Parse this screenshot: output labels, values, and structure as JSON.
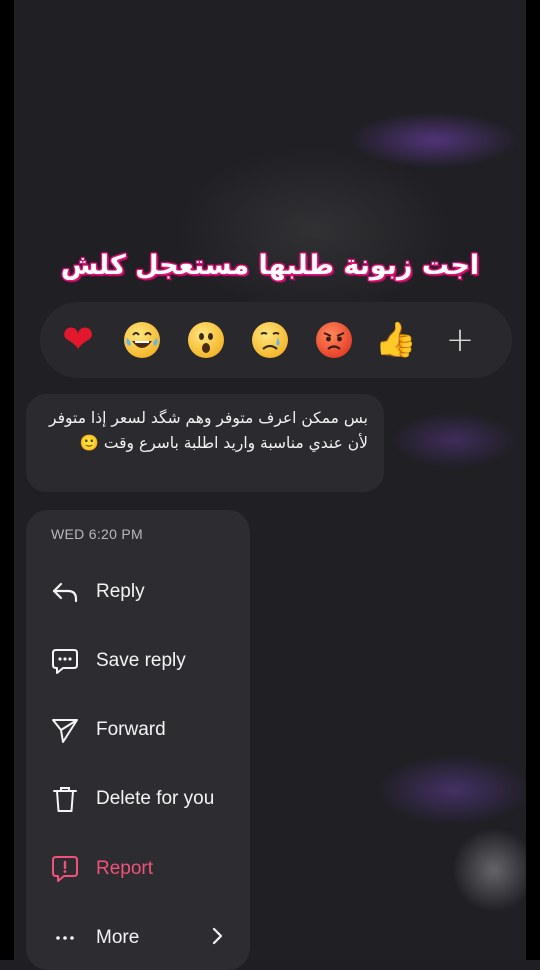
{
  "caption": "اجت زبونة طلبها مستعجل كلش",
  "reactions": [
    {
      "icon": "red-heart-icon"
    },
    {
      "icon": "laughing-tears-icon"
    },
    {
      "icon": "surprised-face-icon"
    },
    {
      "icon": "crying-face-icon"
    },
    {
      "icon": "angry-face-icon"
    },
    {
      "icon": "thumbs-up-icon"
    },
    {
      "icon": "plus-icon"
    }
  ],
  "message": {
    "text": "بس ممكن اعرف متوفر وهم شگد لسعر إذا متوفر لأن عندي مناسبة واريد اطلبة باسرع وقت 🙂"
  },
  "menu": {
    "timestamp": "WED 6:20 PM",
    "items": [
      {
        "label": "Reply",
        "icon": "reply-arrow-icon"
      },
      {
        "label": "Save reply",
        "icon": "save-reply-icon"
      },
      {
        "label": "Forward",
        "icon": "forward-icon"
      },
      {
        "label": "Delete for you",
        "icon": "trash-icon"
      },
      {
        "label": "Report",
        "icon": "report-icon",
        "color": "#f0527a"
      },
      {
        "label": "More",
        "icon": "more-dots-icon"
      }
    ]
  },
  "colors": {
    "caption_outline": "#e8127a",
    "report": "#f0527a",
    "menu_bg": "#2d2c31"
  }
}
